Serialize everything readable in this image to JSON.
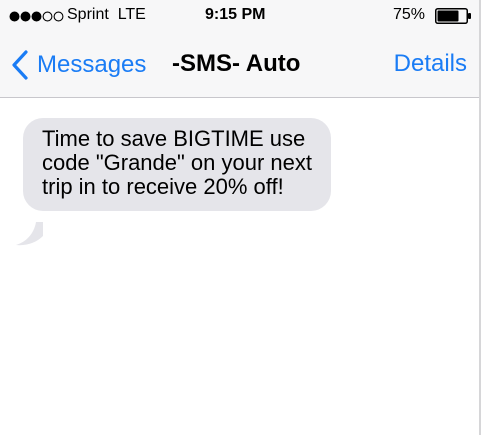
{
  "status_bar": {
    "carrier": "Sprint",
    "network": "LTE",
    "time": "9:15 PM",
    "battery_percent": "75%",
    "battery_level": 0.75,
    "signal_bars": 3,
    "signal_total": 5
  },
  "nav": {
    "back_label": "Messages",
    "title": "-SMS- Auto",
    "details_label": "Details",
    "accent_color": "#1a7cf5"
  },
  "messages": [
    {
      "direction": "incoming",
      "text": "Time to save BIGTIME use code \"Grande\" on your next trip in to receive 20% off!",
      "bubble_color": "#e5e5ea"
    }
  ],
  "icons": [
    "signal-dots-icon",
    "battery-icon",
    "chevron-left-icon"
  ]
}
